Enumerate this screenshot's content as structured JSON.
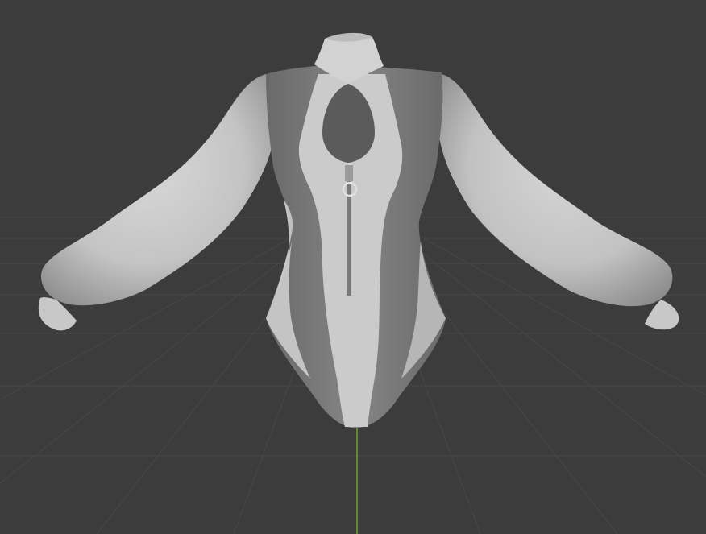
{
  "viewport": {
    "background_color": "#3c3c3c",
    "grid_color": "#4a4a4a",
    "z_axis_color": "#6f9a2e",
    "grid_visible": true
  },
  "model": {
    "kind": "bodysuit-with-puff-sleeves",
    "shading": "solid",
    "light_color": "#c9c9c9",
    "dark_color": "#7a7a7a",
    "icons": [
      "zipper-pull-icon"
    ]
  }
}
